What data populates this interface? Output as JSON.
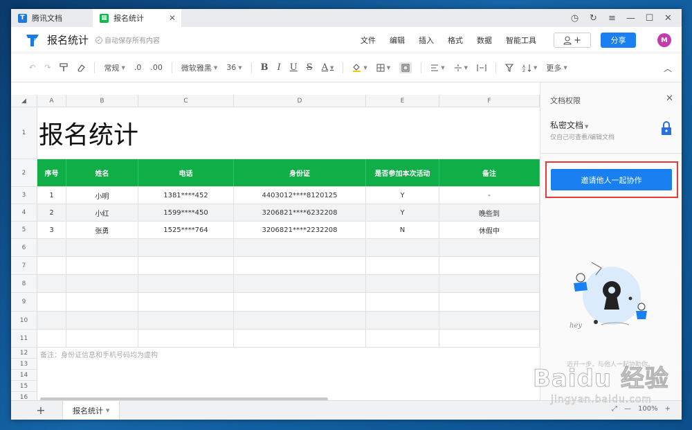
{
  "tabs": [
    {
      "label": "腾讯文档"
    },
    {
      "label": "报名统计"
    }
  ],
  "window_controls": [
    "◷",
    "↻",
    "≡",
    "—",
    "☐",
    "✕"
  ],
  "header": {
    "doc_title": "报名统计",
    "save_status": "自动保存所有内容",
    "menus": [
      "文件",
      "编辑",
      "插入",
      "格式",
      "数据",
      "智能工具"
    ],
    "share_label": "分享",
    "avatar_text": "M",
    "add_collab_plus": "+"
  },
  "toolbar": {
    "number_format": "常规",
    "decimal_decrease": ".0",
    "decimal_increase": ".00",
    "font_family": "微软雅黑",
    "font_size": "36",
    "bold": "B",
    "italic": "I",
    "underline": "U",
    "strike": "S",
    "font_color": "A",
    "more": "更多"
  },
  "sheet": {
    "col_letters": [
      "A",
      "B",
      "C",
      "D",
      "E",
      "F"
    ],
    "row_numbers": [
      "1",
      "2",
      "3",
      "4",
      "5",
      "6",
      "7",
      "8",
      "9",
      "10",
      "11",
      "12",
      "13",
      "14",
      "15",
      "16"
    ],
    "title": "报名统计",
    "headers": [
      "序号",
      "姓名",
      "电话",
      "身份证",
      "是否参加本次活动",
      "备注"
    ],
    "rows": [
      [
        "1",
        "小明",
        "1381****452",
        "4403012****8120125",
        "Y",
        "-"
      ],
      [
        "2",
        "小红",
        "1599****450",
        "3206821****6232208",
        "Y",
        "晚些到"
      ],
      [
        "3",
        "张勇",
        "1525****764",
        "3206821****2232208",
        "N",
        "休假中"
      ]
    ],
    "note": "备注：身份证信息和手机号码均为虚构"
  },
  "bottom": {
    "add_sheet": "+",
    "sheet_tab": "报名统计",
    "zoom": "100%",
    "zoom_minus": "—",
    "zoom_plus": "+"
  },
  "panel": {
    "title": "文档权限",
    "close": "✕",
    "perm_name": "私密文档",
    "perm_desc": "仅自己可查看/编辑文档",
    "invite_label": "邀请他人一起协作",
    "caption": "迈开一步，与他人一起协助你。"
  },
  "watermark": {
    "brand": "Baidu 经验",
    "url": "jingyan.baidu.com"
  },
  "colors": {
    "accent": "#1a7ff0",
    "header_green": "#0fae47",
    "highlight_red": "#e53935"
  }
}
